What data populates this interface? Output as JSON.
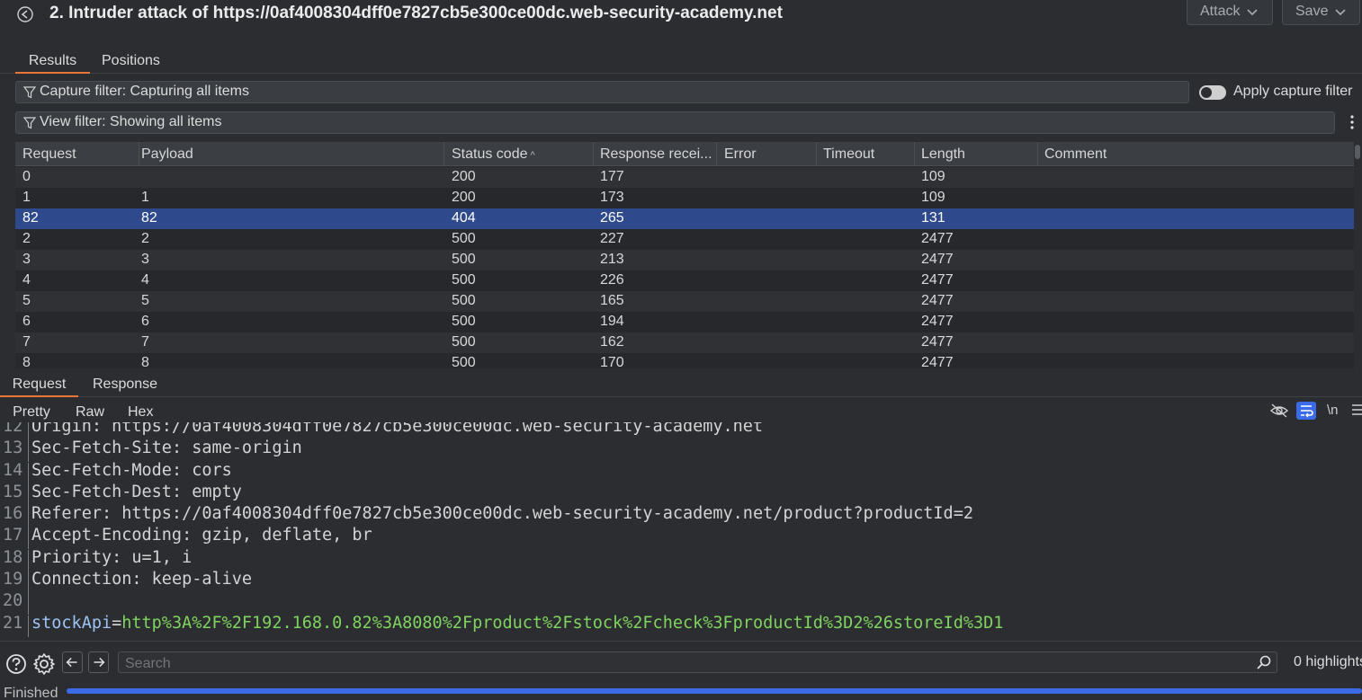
{
  "window": {
    "title": "2. Intruder attack of https://0af4008304dff0e7827cb5e300ce00dc.web-security-academy.net",
    "attack_label": "Attack",
    "save_label": "Save"
  },
  "top_tabs": [
    {
      "label": "Results",
      "active": true
    },
    {
      "label": "Positions",
      "active": false
    }
  ],
  "filters": {
    "capture": "Capture filter: Capturing all items",
    "view": "View filter: Showing all items",
    "apply_capture_label": "Apply capture filter"
  },
  "table": {
    "columns": [
      "Request",
      "Payload",
      "Status code",
      "Response recei...",
      "Error",
      "Timeout",
      "Length",
      "Comment"
    ],
    "sort_column": "Status code",
    "rows": [
      {
        "request": "0",
        "payload": "",
        "status": "200",
        "response": "177",
        "error": "",
        "timeout": "",
        "length": "109",
        "comment": ""
      },
      {
        "request": "1",
        "payload": "1",
        "status": "200",
        "response": "173",
        "error": "",
        "timeout": "",
        "length": "109",
        "comment": ""
      },
      {
        "request": "82",
        "payload": "82",
        "status": "404",
        "response": "265",
        "error": "",
        "timeout": "",
        "length": "131",
        "comment": "",
        "selected": true
      },
      {
        "request": "2",
        "payload": "2",
        "status": "500",
        "response": "227",
        "error": "",
        "timeout": "",
        "length": "2477",
        "comment": ""
      },
      {
        "request": "3",
        "payload": "3",
        "status": "500",
        "response": "213",
        "error": "",
        "timeout": "",
        "length": "2477",
        "comment": ""
      },
      {
        "request": "4",
        "payload": "4",
        "status": "500",
        "response": "226",
        "error": "",
        "timeout": "",
        "length": "2477",
        "comment": ""
      },
      {
        "request": "5",
        "payload": "5",
        "status": "500",
        "response": "165",
        "error": "",
        "timeout": "",
        "length": "2477",
        "comment": ""
      },
      {
        "request": "6",
        "payload": "6",
        "status": "500",
        "response": "194",
        "error": "",
        "timeout": "",
        "length": "2477",
        "comment": ""
      },
      {
        "request": "7",
        "payload": "7",
        "status": "500",
        "response": "162",
        "error": "",
        "timeout": "",
        "length": "2477",
        "comment": ""
      },
      {
        "request": "8",
        "payload": "8",
        "status": "500",
        "response": "170",
        "error": "",
        "timeout": "",
        "length": "2477",
        "comment": ""
      }
    ]
  },
  "detail_tabs": [
    {
      "label": "Request",
      "active": true
    },
    {
      "label": "Response",
      "active": false
    }
  ],
  "format_tabs": [
    {
      "label": "Pretty",
      "active": true
    },
    {
      "label": "Raw",
      "active": false
    },
    {
      "label": "Hex",
      "active": false
    }
  ],
  "newline_label": "\\n",
  "code_lines": [
    {
      "n": "12",
      "key": "Origin",
      "value": " https://0af4008304dff0e7827cb5e300ce00dc.web-security-academy.net"
    },
    {
      "n": "13",
      "key": "Sec-Fetch-Site",
      "value": " same-origin"
    },
    {
      "n": "14",
      "key": "Sec-Fetch-Mode",
      "value": " cors"
    },
    {
      "n": "15",
      "key": "Sec-Fetch-Dest",
      "value": " empty"
    },
    {
      "n": "16",
      "key": "Referer",
      "value": " https://0af4008304dff0e7827cb5e300ce00dc.web-security-academy.net/product?productId=2"
    },
    {
      "n": "17",
      "key": "Accept-Encoding",
      "value": " gzip, deflate, br"
    },
    {
      "n": "18",
      "key": "Priority",
      "value": " u=1, i"
    },
    {
      "n": "19",
      "key": "Connection",
      "value": " keep-alive"
    },
    {
      "n": "20",
      "key": "",
      "value": ""
    },
    {
      "n": "21",
      "param": "stockApi",
      "param_value": "http%3A%2F%2F192.168.0.82%3A8080%2Fproduct%2Fstock%2Fcheck%3FproductId%3D2%26storeId%3D1"
    }
  ],
  "search": {
    "placeholder": "Search",
    "highlights": "0 highlights"
  },
  "status": {
    "text": "Finished",
    "progress": 1.0
  },
  "colors": {
    "accent": "#e8753a",
    "selection": "#2f4a8c",
    "progress": "#3c6be8",
    "param_value": "#7fd35f"
  }
}
